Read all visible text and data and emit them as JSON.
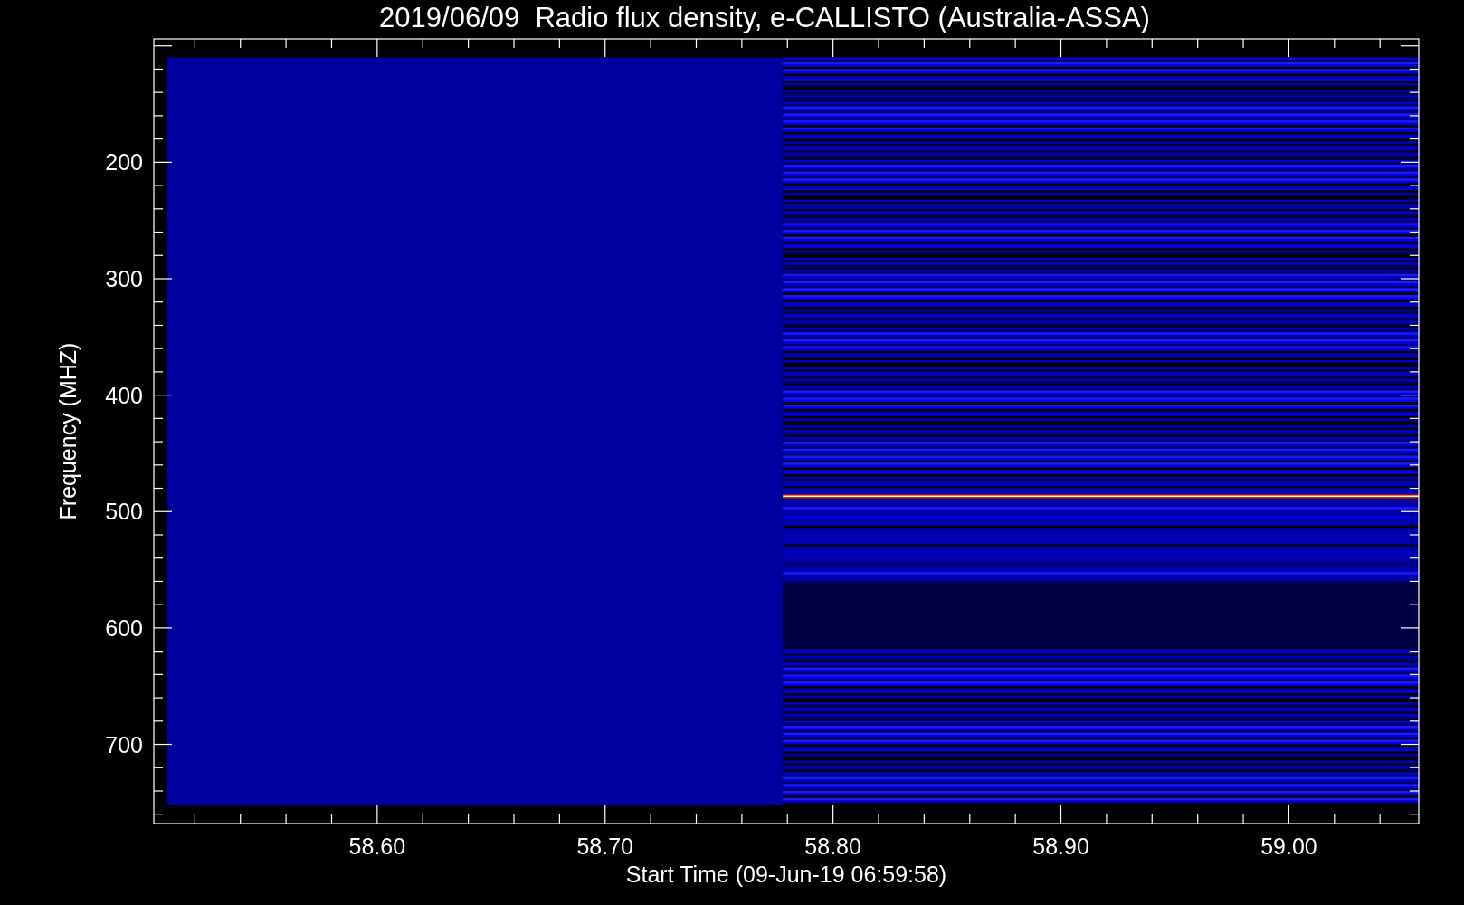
{
  "plot": {
    "title": "2019/06/09  Radio flux density, e-CALLISTO (Australia-ASSA)",
    "xlabel": "Start Time (09-Jun-19 06:59:58)",
    "ylabel": "Frequency (MHZ)",
    "xticks": [
      "58.60",
      "58.70",
      "58.80",
      "58.90",
      "59.00"
    ],
    "yticks": [
      "200",
      "300",
      "400",
      "500",
      "600",
      "700"
    ]
  }
}
